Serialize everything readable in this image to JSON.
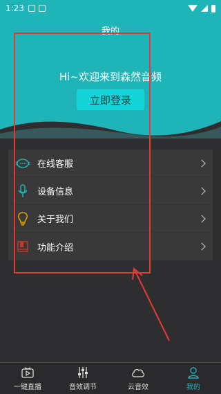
{
  "statusbar": {
    "time": "1:23"
  },
  "header": {
    "title": "我的",
    "welcome": "Hi~欢迎来到森然音频",
    "login_label": "立即登录"
  },
  "menu": {
    "items": [
      {
        "label": "在线客服",
        "icon": "chat-icon",
        "color": "#1fb5b8"
      },
      {
        "label": "设备信息",
        "icon": "microphone-icon",
        "color": "#1fb5b8"
      },
      {
        "label": "关于我们",
        "icon": "lightbulb-icon",
        "color": "#e6a100"
      },
      {
        "label": "功能介绍",
        "icon": "book-icon",
        "color": "#c0392b"
      }
    ]
  },
  "bottomnav": {
    "items": [
      {
        "label": "一键直播",
        "icon": "tv-play-icon"
      },
      {
        "label": "音效调节",
        "icon": "sliders-icon"
      },
      {
        "label": "云音效",
        "icon": "cloud-icon"
      },
      {
        "label": "我的",
        "icon": "person-icon",
        "active": true
      }
    ]
  },
  "colors": {
    "accent": "#1fb5b8",
    "annotation": "#e53935",
    "background": "#2e2e30"
  }
}
